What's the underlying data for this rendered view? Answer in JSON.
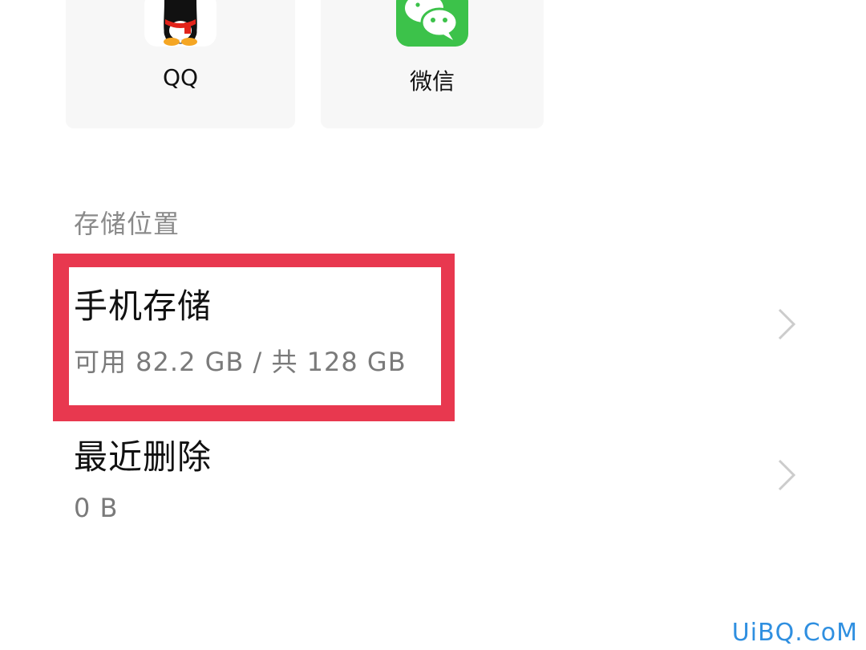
{
  "apps": [
    {
      "label": "QQ",
      "icon": "qq-penguin-icon"
    },
    {
      "label": "微信",
      "icon": "wechat-icon"
    }
  ],
  "section_title": "存储位置",
  "storage_items": [
    {
      "title": "手机存储",
      "subtitle": "可用 82.2 GB / 共 128 GB"
    },
    {
      "title": "最近删除",
      "subtitle": "0 B"
    }
  ],
  "highlight_color": "#e8384f",
  "watermark": "UiBQ.CoM"
}
